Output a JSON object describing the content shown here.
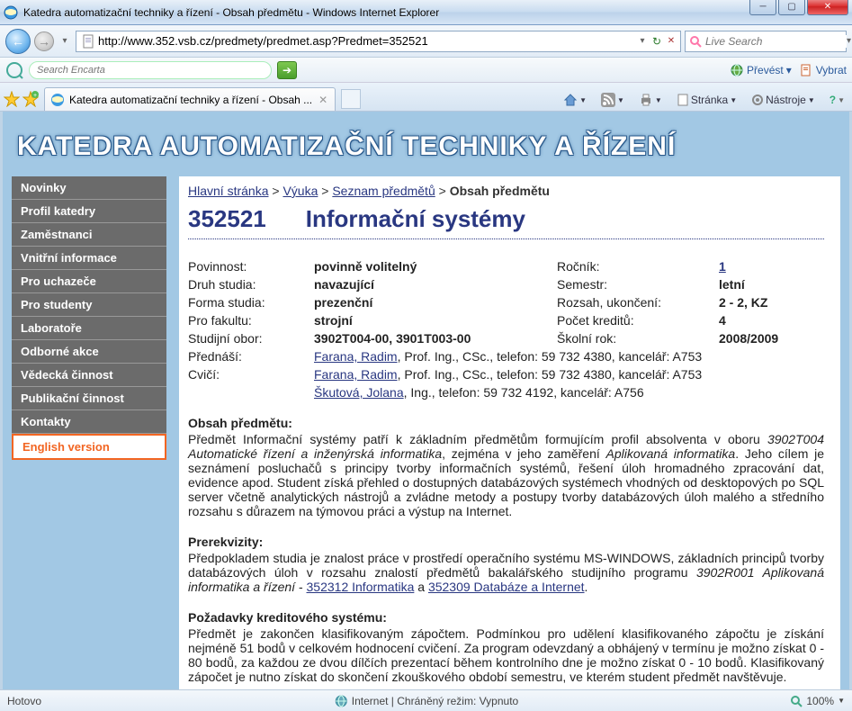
{
  "window": {
    "title": "Katedra automatizační techniky a řízení - Obsah předmětu - Windows Internet Explorer"
  },
  "address": {
    "url": "http://www.352.vsb.cz/predmety/predmet.asp?Predmet=352521"
  },
  "live_search": {
    "placeholder": "Live Search"
  },
  "encarta": {
    "placeholder": "Search Encarta",
    "translate": "Převést",
    "select": "Vybrat"
  },
  "tab": {
    "title": "Katedra automatizační techniky a řízení - Obsah ..."
  },
  "ie_tools": {
    "page": "Stránka",
    "tools": "Nástroje"
  },
  "site": {
    "title": "KATEDRA AUTOMATIZAČNÍ TECHNIKY A ŘÍZENÍ"
  },
  "sidebar": {
    "items": [
      "Novinky",
      "Profil katedry",
      "Zaměstnanci",
      "Vnitřní informace",
      "Pro uchazeče",
      "Pro studenty",
      "Laboratoře",
      "Odborné akce",
      "Vědecká činnost",
      "Publikační činnost",
      "Kontakty"
    ],
    "english": "English version"
  },
  "breadcrumb": {
    "home": "Hlavní stránka",
    "teach": "Výuka",
    "list": "Seznam předmětů",
    "current": "Obsah předmětu",
    "sep": ">"
  },
  "subject": {
    "code": "352521",
    "name": "Informační systémy",
    "rows": {
      "povinnost_l": "Povinnost:",
      "povinnost_v": "povinně volitelný",
      "rocnik_l": "Ročník:",
      "rocnik_v": "1",
      "druh_l": "Druh studia:",
      "druh_v": "navazující",
      "semestr_l": "Semestr:",
      "semestr_v": "letní",
      "forma_l": "Forma studia:",
      "forma_v": "prezenční",
      "rozsah_l": "Rozsah, ukončení:",
      "rozsah_v": "2 - 2, KZ",
      "fakulta_l": "Pro fakultu:",
      "fakulta_v": "strojní",
      "kredity_l": "Počet kreditů:",
      "kredity_v": "4",
      "obor_l": "Studijní obor:",
      "obor_v": "3902T004-00, 3901T003-00",
      "rok_l": "Školní rok:",
      "rok_v": "2008/2009"
    },
    "lecturer_l": "Přednáší:",
    "lecturer_link": "Farana, Radim",
    "lecturer_rest": ", Prof. Ing., CSc., telefon: 59 732 4380, kancelář: A753",
    "trainer_l": "Cvičí:",
    "trainer1_link": "Farana, Radim",
    "trainer1_rest": ", Prof. Ing., CSc., telefon: 59 732 4380, kancelář: A753",
    "trainer2_link": "Škutová, Jolana",
    "trainer2_rest": ", Ing., telefon: 59 732 4192, kancelář: A756"
  },
  "sections": {
    "obsah_h": "Obsah předmětu:",
    "obsah_p1a": "Předmět Informační systémy patří k základním předmětům formujícím profil absolventa v oboru ",
    "obsah_i1": "3902T004 Automatické řízení a inženýrská informatika",
    "obsah_p1b": ", zejména v jeho zaměření ",
    "obsah_i2": "Aplikovaná informatika",
    "obsah_p1c": ". Jeho cílem je seznámení posluchačů s principy tvorby informačních systémů, řešení úloh hromadného zpracování dat, evidence apod. Student získá přehled o dostupných databázových systémech vhodných od desktopových po SQL server včetně analytických nástrojů a zvládne metody a postupy tvorby databázových úloh malého a středního rozsahu s důrazem na týmovou práci a výstup na Internet.",
    "prereq_h": "Prerekvizity:",
    "prereq_p1a": "Předpokladem studia je znalost práce v prostředí operačního systému MS-WINDOWS, základních principů tvorby databázových úloh v rozsahu znalostí předmětů bakalářského studijního programu ",
    "prereq_i1": "3902R001 Aplikovaná informatika a řízení",
    "prereq_dash": " - ",
    "prereq_link1": "352312 Informatika",
    "prereq_and": " a ",
    "prereq_link2": "352309 Databáze a Internet",
    "prereq_dot": ".",
    "kredit_h": "Požadavky kreditového systému:",
    "kredit_p": "Předmět je zakončen klasifikovaným zápočtem. Podmínkou pro udělení klasifikovaného zápočtu je získání nejméně 51 bodů v celkovém hodnocení cvičení. Za program odevzdaný a obhájený v termínu je možno získat 0 - 80 bodů, za každou ze dvou dílčích prezentací během kontrolního dne je možno získat 0 - 10 bodů. Klasifikovaný zápočet je nutno získat do skončení zkouškového období semestru, ve kterém student předmět navštěvuje."
  },
  "status": {
    "left": "Hotovo",
    "center": "Internet | Chráněný režim: Vypnuto",
    "zoom": "100%"
  }
}
